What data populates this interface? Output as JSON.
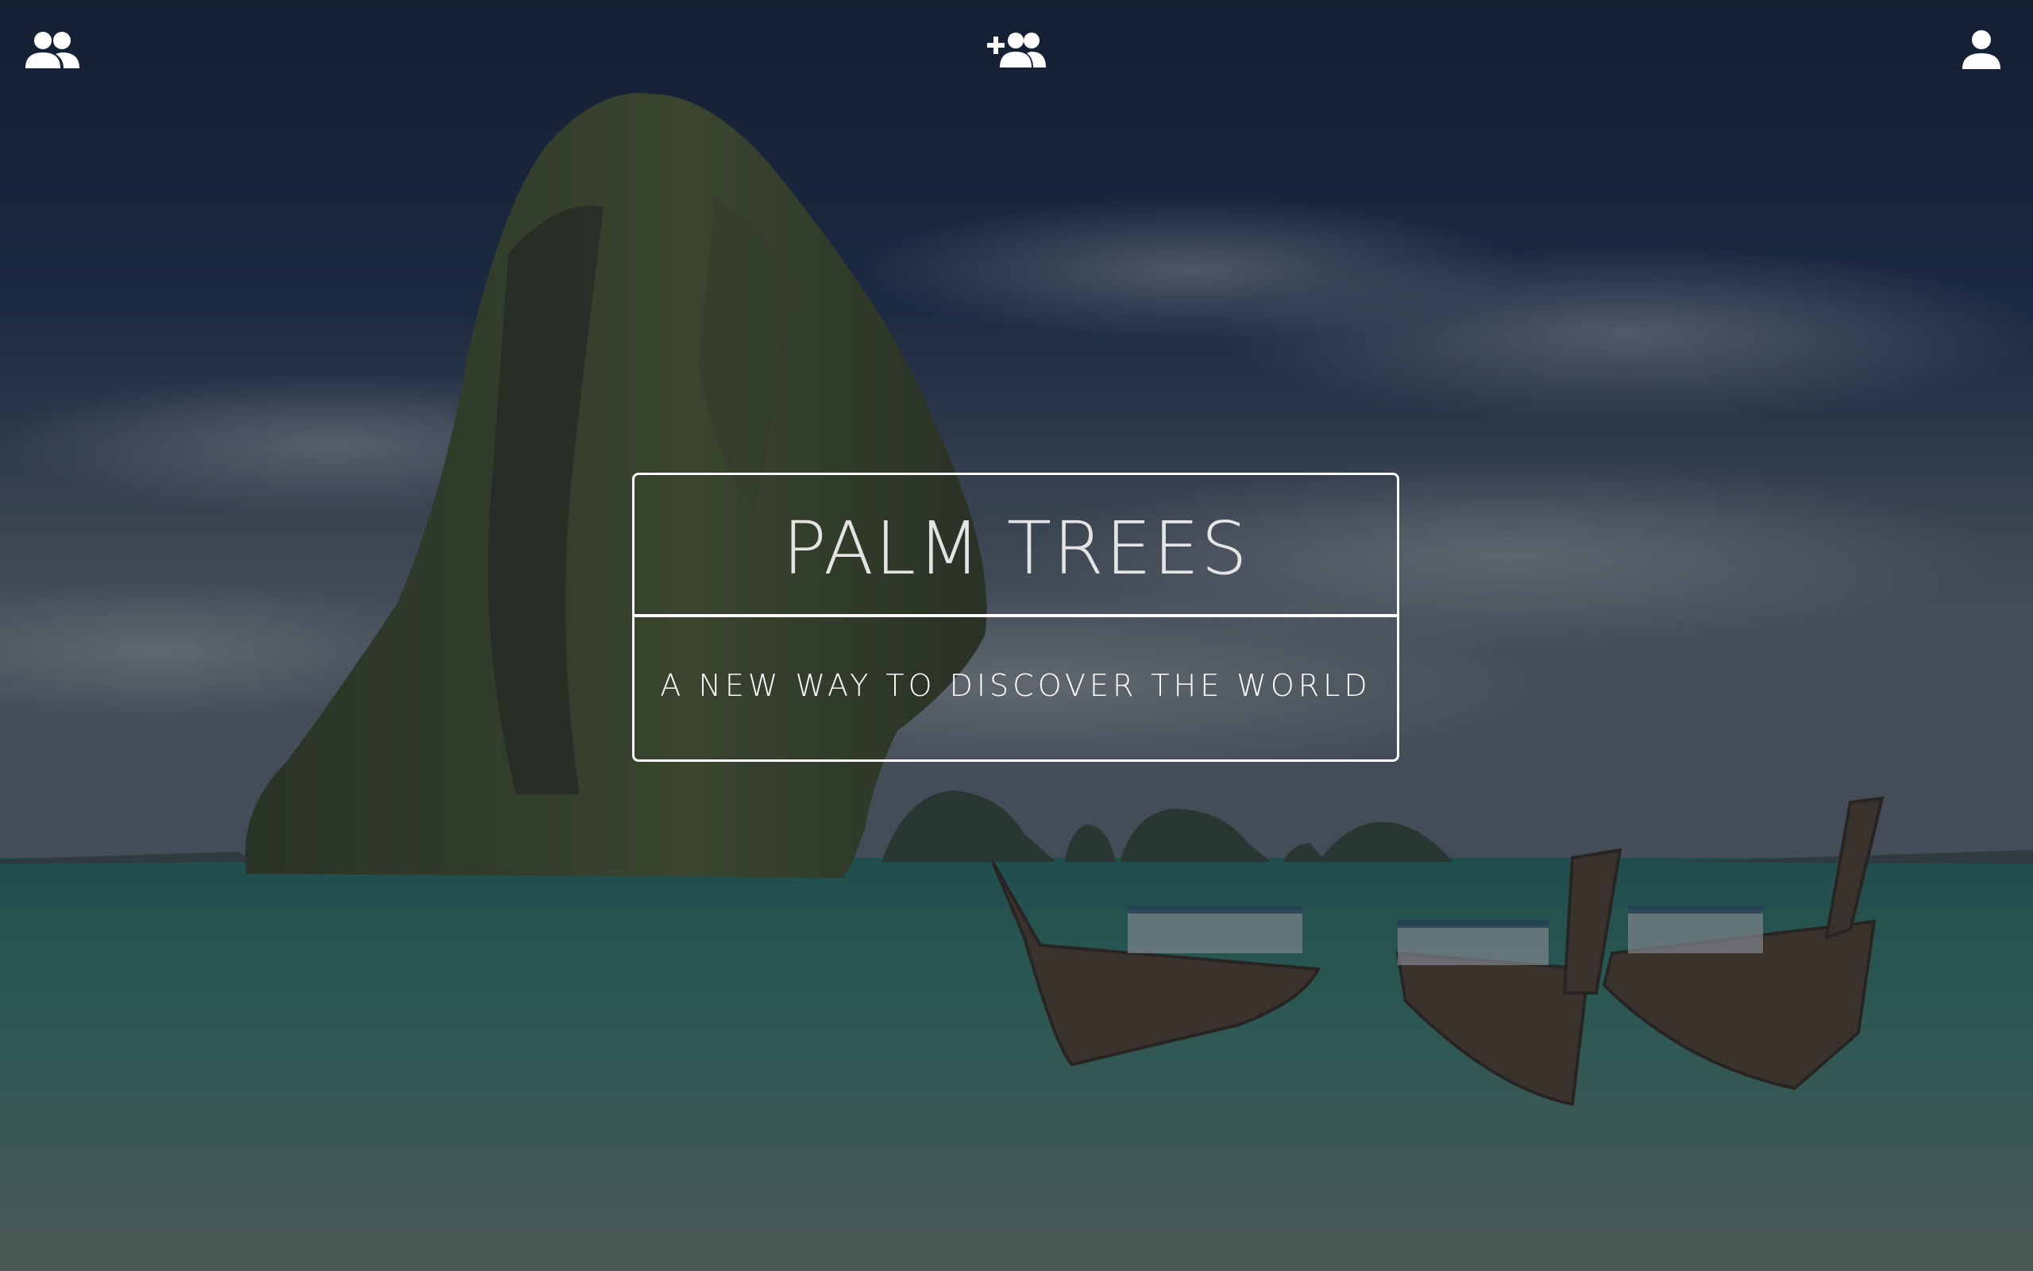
{
  "hero": {
    "title": "PALM TREES",
    "subtitle": "A NEW WAY TO DISCOVER THE WORLD"
  },
  "nav": {
    "left_icon": "people-group-icon",
    "center_icon": "add-friend-icon",
    "right_icon": "user-profile-icon"
  },
  "colors": {
    "icon": "#ffffff",
    "text": "#ffffff",
    "border": "#ffffff",
    "sky": "#1b2b44",
    "sea": "#2f6f63"
  }
}
